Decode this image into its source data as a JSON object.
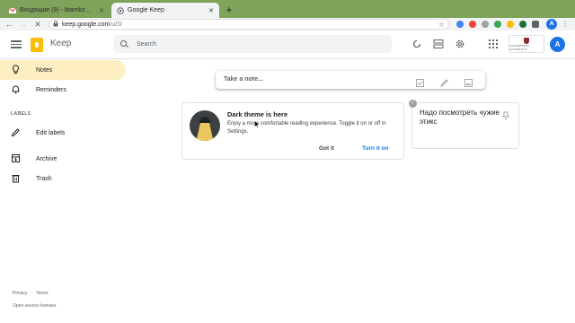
{
  "browser": {
    "tabs": [
      {
        "title": "Входящие (9) - lbarnkz@gmail.",
        "favicon": "gmail-icon",
        "active": false
      },
      {
        "title": "Google Keep",
        "favicon": "keep-icon",
        "active": true
      }
    ],
    "url": {
      "host": "keep.google.com",
      "path": "/u/0/"
    },
    "profile_initial": "A"
  },
  "header": {
    "app_title": "Keep",
    "search_placeholder": "Search",
    "avatar_initial": "A",
    "org_logo_text": "NAZARBAYEV UNIVERSITY"
  },
  "sidebar": {
    "items": [
      {
        "label": "Notes",
        "icon": "lightbulb-icon",
        "active": true
      },
      {
        "label": "Reminders",
        "icon": "bell-icon",
        "active": false
      },
      {
        "label": "Edit labels",
        "icon": "pencil-icon",
        "active": false
      },
      {
        "label": "Archive",
        "icon": "archive-icon",
        "active": false
      },
      {
        "label": "Trash",
        "icon": "trash-icon",
        "active": false
      }
    ],
    "labels_heading": "LABELS",
    "footer": {
      "privacy": "Privacy",
      "terms": "Terms",
      "oss": "Open-source licenses"
    }
  },
  "main": {
    "take_note_placeholder": "Take a note...",
    "promo": {
      "title": "Dark theme is here",
      "body": "Enjoy a more comfortable reading experience. Toggle it on or off in Settings.",
      "dismiss_label": "Got it",
      "action_label": "Turn it on"
    },
    "notes": [
      {
        "title": "Надо посмотреть чужие этикс"
      }
    ]
  },
  "colors": {
    "tabstrip": "#7fa35b",
    "active_nav": "#feefc3",
    "keep_yellow": "#fbbc04",
    "link_blue": "#1a73e8"
  }
}
